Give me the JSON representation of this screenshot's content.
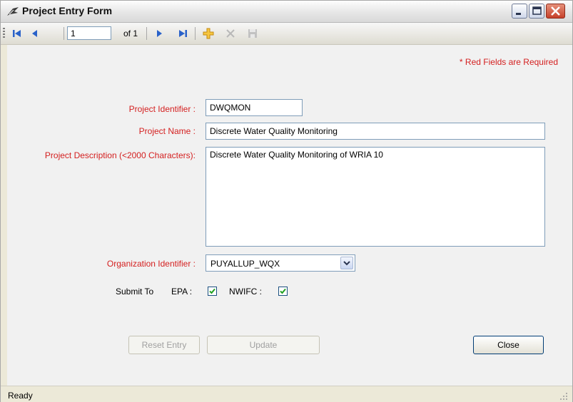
{
  "window": {
    "title": "Project Entry Form"
  },
  "toolbar": {
    "position_value": "1",
    "of_label": "of 1",
    "icons": [
      "first-record-icon",
      "prev-record-icon",
      "next-record-icon",
      "last-record-icon",
      "add-new-icon",
      "delete-icon",
      "save-icon"
    ]
  },
  "form": {
    "required_note": "* Red Fields are Required",
    "project_identifier_label": "Project Identifier :",
    "project_identifier_value": "DWQMON",
    "project_name_label": "Project Name :",
    "project_name_value": "Discrete Water Quality Monitoring",
    "project_description_label": "Project Description (<2000 Characters):",
    "project_description_value": "Discrete Water Quality Monitoring of WRIA 10",
    "organization_identifier_label": "Organization Identifier :",
    "organization_identifier_value": "PUYALLUP_WQX",
    "submit_to_label": "Submit To",
    "epa_label": "EPA :",
    "epa_checked": true,
    "nwifc_label": "NWIFC :",
    "nwifc_checked": true
  },
  "buttons": {
    "reset_label": "Reset Entry",
    "update_label": "Update",
    "close_label": "Close"
  },
  "status": {
    "text": "Ready"
  },
  "colors": {
    "required_red": "#d42020"
  }
}
